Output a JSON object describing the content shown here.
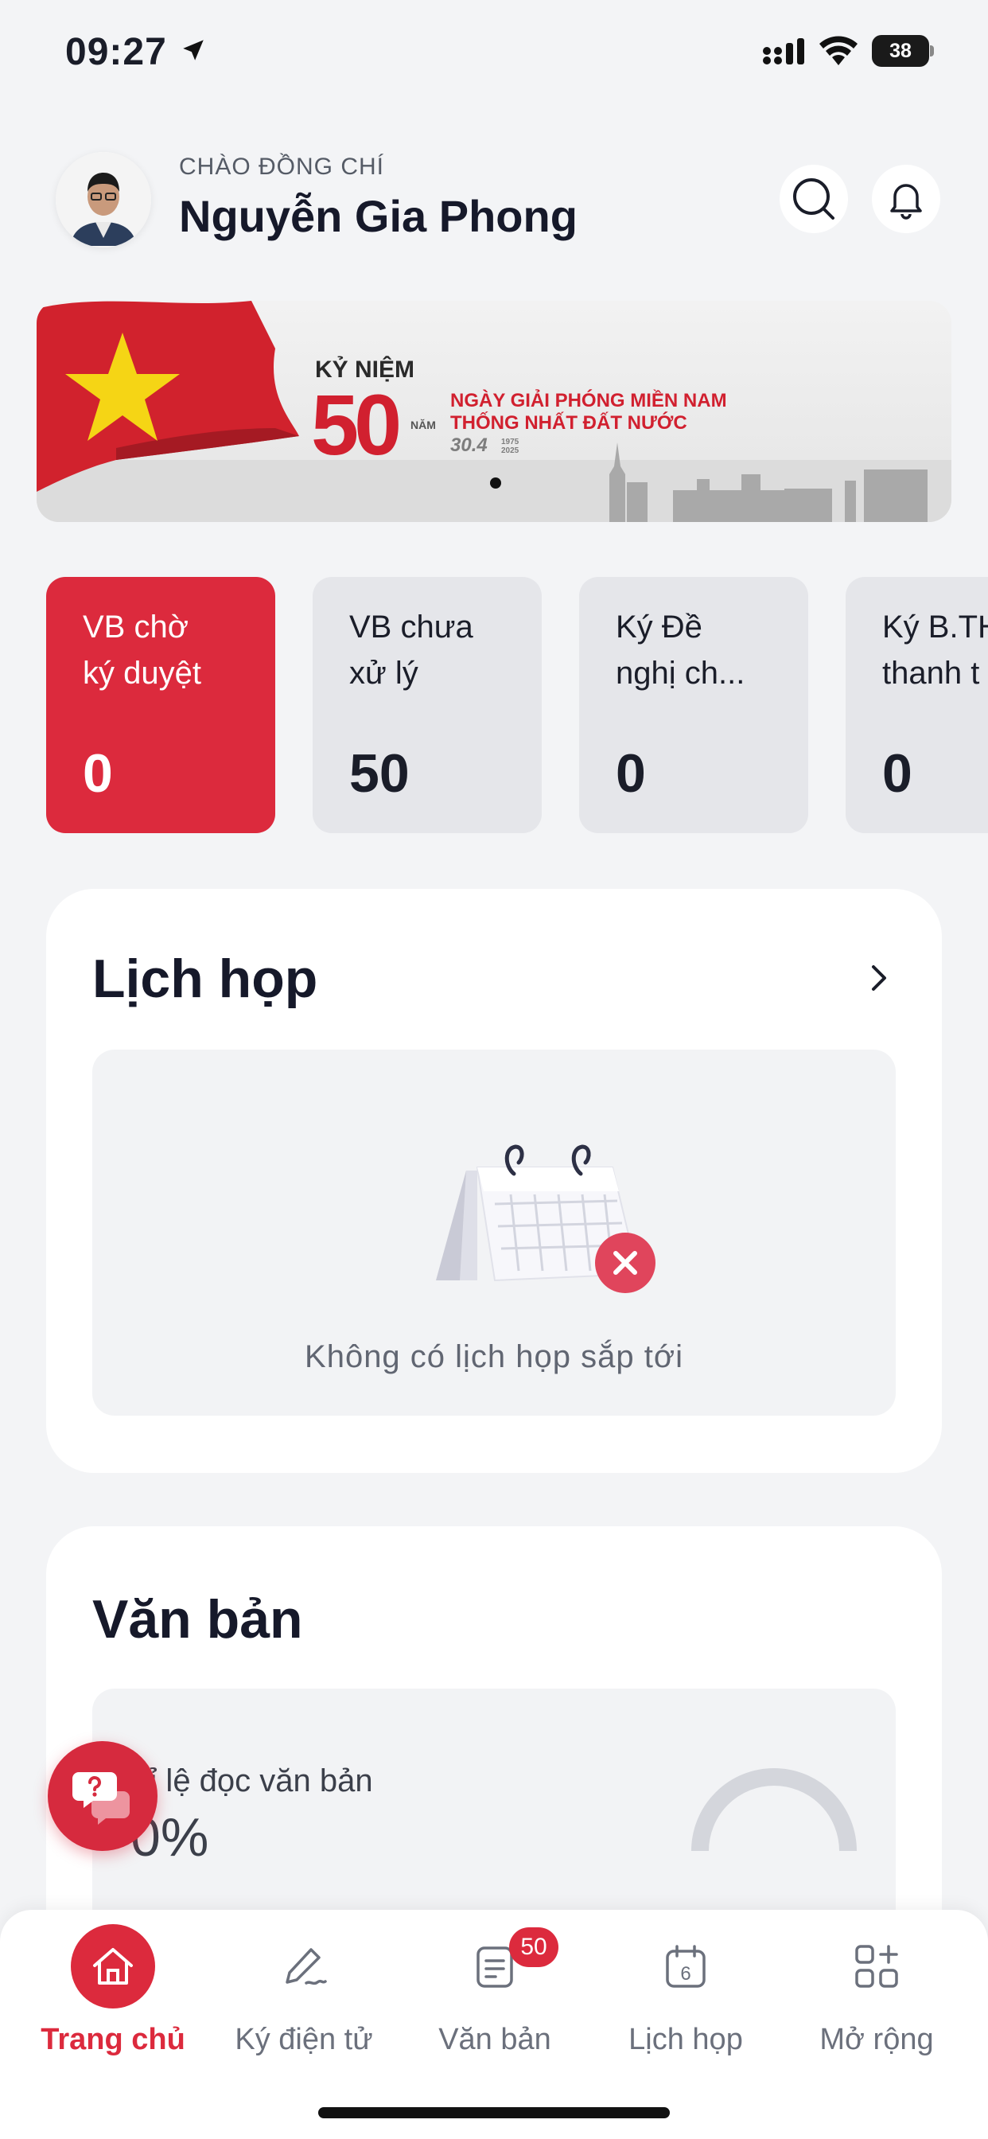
{
  "status_bar": {
    "time": "09:27",
    "battery": "38"
  },
  "header": {
    "greeting": "CHÀO ĐỒNG CHÍ",
    "user_name": "Nguyễn Gia Phong"
  },
  "banner": {
    "kicker": "KỶ NIỆM",
    "number": "50",
    "nam": "NĂM",
    "line1": "NGÀY GIẢI PHÓNG MIỀN NAM",
    "line2": "THỐNG NHẤT ĐẤT NƯỚC",
    "date": "30.4",
    "years_from": "1975",
    "years_to": "2025"
  },
  "stats": [
    {
      "label": "VB chờ\nký duyệt",
      "value": "0"
    },
    {
      "label": "VB chưa\nxử lý",
      "value": "50"
    },
    {
      "label": "Ký Đề\nnghị ch...",
      "value": "0"
    },
    {
      "label": "Ký B.TH\nthanh t",
      "value": "0"
    }
  ],
  "meetings": {
    "title": "Lịch họp",
    "empty_text": "Không có lịch họp sắp tới"
  },
  "documents": {
    "title": "Văn bản",
    "read_label": "Tỉ lệ đọc văn bản",
    "read_value": "0%"
  },
  "nav": [
    {
      "label": "Trang chủ",
      "icon": "home-icon"
    },
    {
      "label": "Ký điện tử",
      "icon": "pen-icon"
    },
    {
      "label": "Văn bản",
      "icon": "document-icon",
      "badge": "50"
    },
    {
      "label": "Lịch họp",
      "icon": "calendar-icon",
      "calendar_day": "6"
    },
    {
      "label": "Mở rộng",
      "icon": "apps-icon"
    }
  ],
  "colors": {
    "accent": "#dc2a3d",
    "background": "#f3f4f6",
    "card_inactive": "#e5e6ea"
  }
}
